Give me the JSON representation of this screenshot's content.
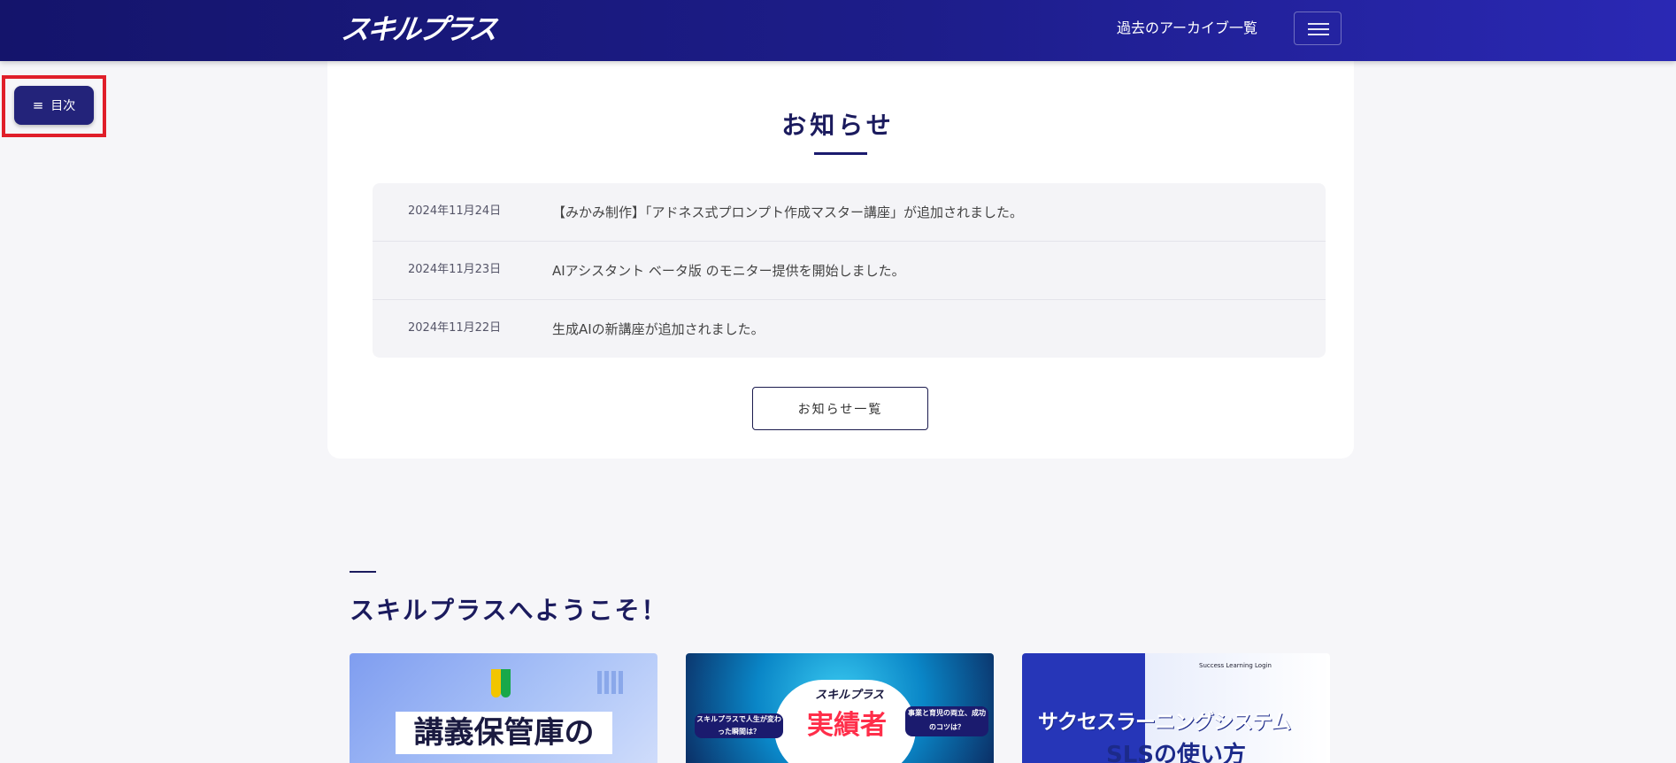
{
  "header": {
    "logo_text": "スキルプラス",
    "archive_link": "過去のアーカイブ一覧",
    "menu_icon": "hamburger-icon"
  },
  "toc": {
    "icon": "list-icon",
    "label": "目次"
  },
  "news": {
    "title": "お知らせ",
    "items": [
      {
        "date": "2024年11月24日",
        "text": "【みかみ制作】「アドネス式プロンプト作成マスター講座」が追加されました。"
      },
      {
        "date": "2024年11月23日",
        "text": "AIアシスタント ベータ版 のモニター提供を開始しました。"
      },
      {
        "date": "2024年11月22日",
        "text": "生成AIの新講座が追加されました。"
      }
    ],
    "more_button": "お知らせ一覧"
  },
  "welcome": {
    "title": "スキルプラスへようこそ！",
    "cards": [
      {
        "title_line1": "講義保管庫の"
      },
      {
        "badge_left": "スキルプラスで人生が変わった瞬間は？",
        "main": "実績者",
        "badge_right": "事業と育児の両立、成功のコツは？",
        "logo": "スキルプラス"
      },
      {
        "top_small": "Success Learning Login",
        "title": "サクセスラーニングシステム",
        "sub": "SLSの使い方"
      }
    ]
  },
  "colors": {
    "header_gradient_start": "#14146b",
    "header_gradient_end": "#2a28b4",
    "toc_button": "#23237a",
    "highlight": "#e01f2a",
    "heading": "#1b1b5e"
  }
}
